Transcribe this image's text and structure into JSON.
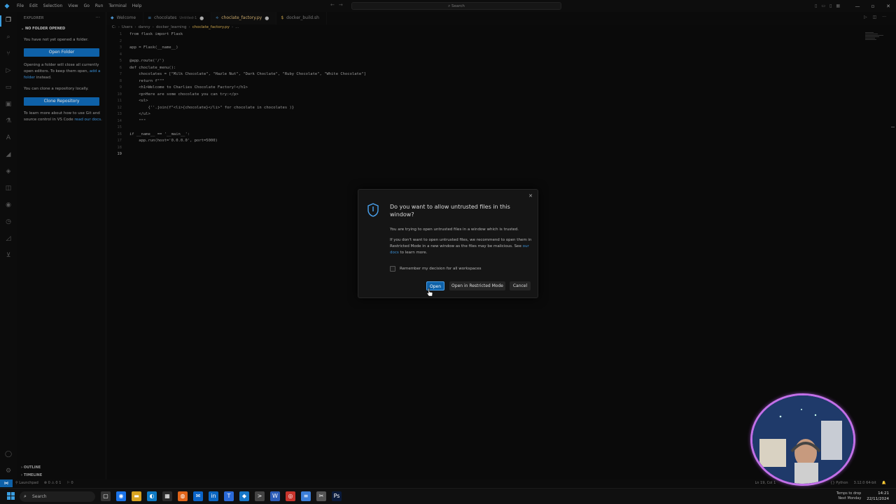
{
  "titlebar": {
    "menu": [
      "File",
      "Edit",
      "Selection",
      "View",
      "Go",
      "Run",
      "Terminal",
      "Help"
    ],
    "search": "Search"
  },
  "sidebar": {
    "title": "EXPLORER",
    "section": "NO FOLDER OPENED",
    "no_folder_text": "You have not yet opened a folder.",
    "open_folder_button": "Open Folder",
    "opening_text_1": "Opening a folder will close all currently open editors. To keep them open, ",
    "opening_link": "add a folder",
    "opening_text_2": " instead.",
    "clone_text": "You can clone a repository locally.",
    "clone_button": "Clone Repository",
    "learn_text": "To learn more about how to use Git and source control in VS Code ",
    "learn_link": "read our docs",
    "learn_text_end": ".",
    "outline": "OUTLINE",
    "timeline": "TIMELINE"
  },
  "tabs": [
    {
      "label": "Welcome",
      "sub": "",
      "active": false
    },
    {
      "label": "chocolates",
      "sub": "Untitled-1",
      "active": false
    },
    {
      "label": "choclate_factory.py",
      "sub": "",
      "active": true
    },
    {
      "label": "docker_build.sh",
      "sub": "",
      "active": false
    }
  ],
  "breadcrumb": [
    "C:",
    "Users",
    "danny",
    "docker_learning",
    "choclate_factory.py",
    "..."
  ],
  "code_lines": [
    {
      "n": "1",
      "text": "from flask import Flask"
    },
    {
      "n": "2",
      "text": ""
    },
    {
      "n": "3",
      "text": "app = Flask(__name__)"
    },
    {
      "n": "4",
      "text": ""
    },
    {
      "n": "5",
      "text": "@app.route('/')"
    },
    {
      "n": "6",
      "text": "def choclate_menu():"
    },
    {
      "n": "7",
      "text": "    chocolates = [\"Milk Chocolate\", \"Hazle Nut\", \"Dark Choclate\", \"Ruby Chocolate\", \"White Chocolate\"]"
    },
    {
      "n": "8",
      "text": "    return f\"\"\""
    },
    {
      "n": "9",
      "text": "    <h1>Welcome to Charlies Chocolate Factory!</h1>"
    },
    {
      "n": "10",
      "text": "    <p>Here are some chocolate you can try:</p>"
    },
    {
      "n": "11",
      "text": "    <ul>"
    },
    {
      "n": "12",
      "text": "        {''.join(f\"<li>{chocolate}</li>\" for chocolate in chocolates )}"
    },
    {
      "n": "13",
      "text": "    </ul>"
    },
    {
      "n": "14",
      "text": "    \"\"\""
    },
    {
      "n": "15",
      "text": ""
    },
    {
      "n": "16",
      "text": "if __name__ == '__main__':"
    },
    {
      "n": "17",
      "text": "    app.run(host='0.0.0.0', port=5000)"
    },
    {
      "n": "18",
      "text": ""
    },
    {
      "n": "19",
      "text": ""
    }
  ],
  "dialog": {
    "title": "Do you want to allow untrusted files in this window?",
    "body_1": "You are trying to open untrusted files in a window which is trusted.",
    "body_2": "If you don't want to open untrusted files, we recommend to open them in Restricted Mode in a new window as the files may be malicious. See ",
    "body_2_link": "our docs",
    "body_2_end": " to learn more.",
    "checkbox_label": "Remember my decision for all workspaces",
    "open_button": "Open",
    "restricted_button": "Open in Restricted Mode",
    "cancel_button": "Cancel"
  },
  "statusbar": {
    "launchpad": "Launchpad",
    "problems": "0 ⚠ 0 1",
    "ports": "0",
    "position": "Ln 19, Col 1",
    "language": "Python",
    "interpreter": "3.12.0 64-bit"
  },
  "taskbar": {
    "search": "Search",
    "weather_1": "Temps to drop",
    "weather_2": "Next Monday",
    "time": "14:21",
    "date": "22/11/2024"
  },
  "colors": {
    "accent": "#0e61a8",
    "link": "#3a8fd6",
    "webcam_ring": "#d88cf2"
  }
}
